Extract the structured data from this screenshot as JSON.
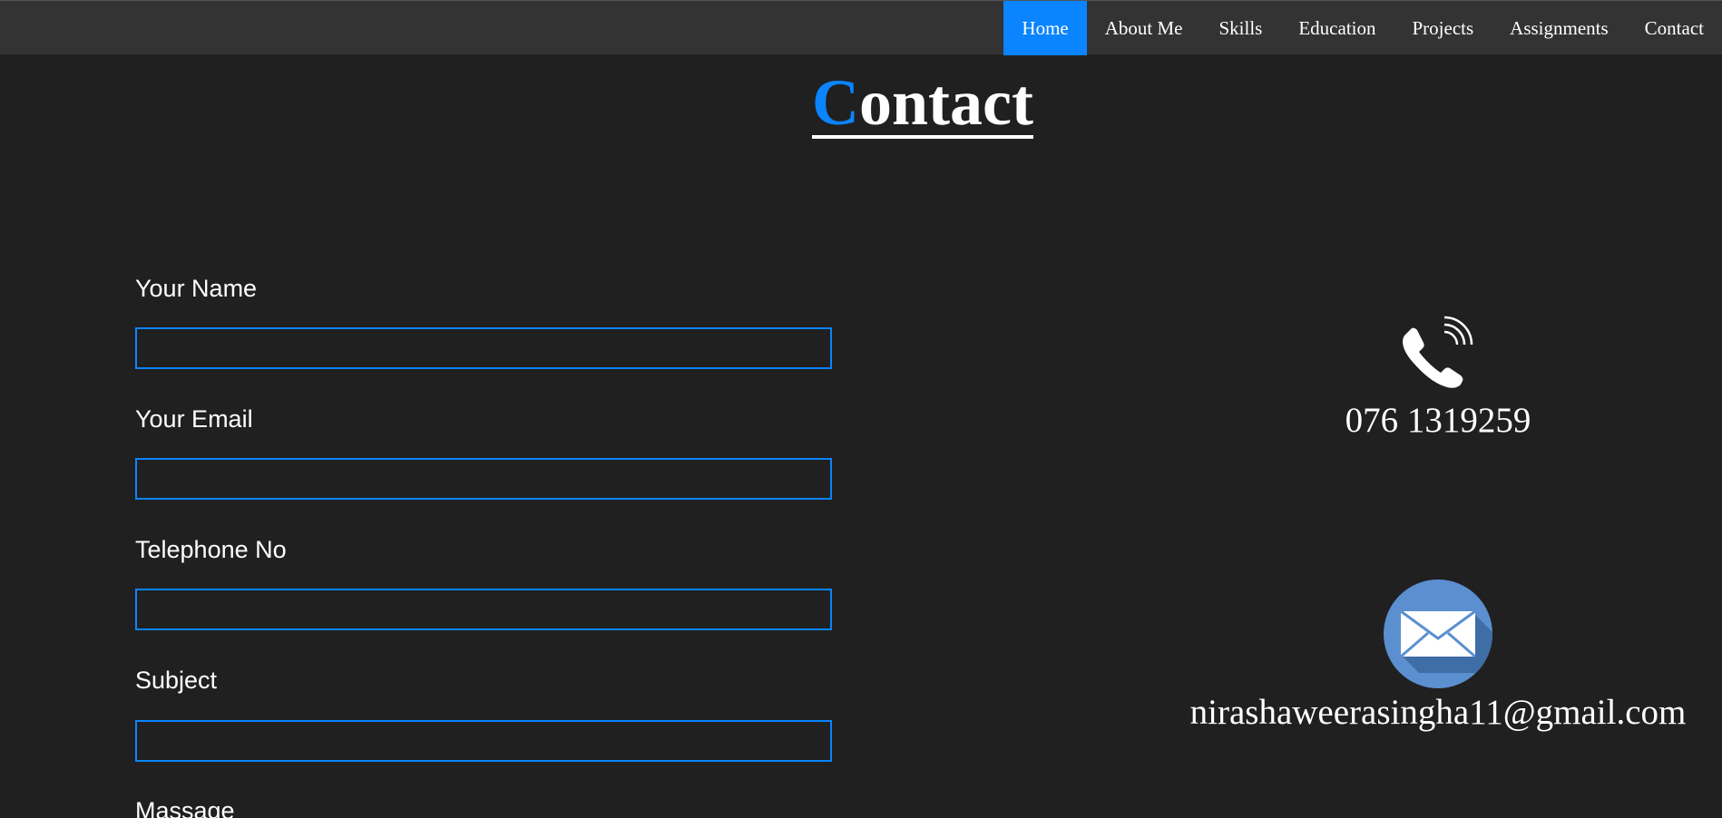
{
  "nav": {
    "items": [
      {
        "label": "Home",
        "active": true
      },
      {
        "label": "About Me",
        "active": false
      },
      {
        "label": "Skills",
        "active": false
      },
      {
        "label": "Education",
        "active": false
      },
      {
        "label": "Projects",
        "active": false
      },
      {
        "label": "Assignments",
        "active": false
      },
      {
        "label": "Contact",
        "active": false
      }
    ]
  },
  "page": {
    "title_first_letter": "C",
    "title_rest": "ontact"
  },
  "form": {
    "name_label": "Your Name",
    "name_value": "",
    "email_label": "Your Email",
    "email_value": "",
    "phone_label": "Telephone No",
    "phone_value": "",
    "subject_label": "Subject",
    "subject_value": "",
    "message_label": "Massage"
  },
  "contact": {
    "phone": "076 1319259",
    "phone_icon": "phone-icon",
    "email": "nirashaweerasingha11@gmail.com",
    "email_icon": "envelope-icon"
  },
  "colors": {
    "background": "#202020",
    "navbar": "#333333",
    "accent": "#0a84ff",
    "text": "#ffffff"
  }
}
